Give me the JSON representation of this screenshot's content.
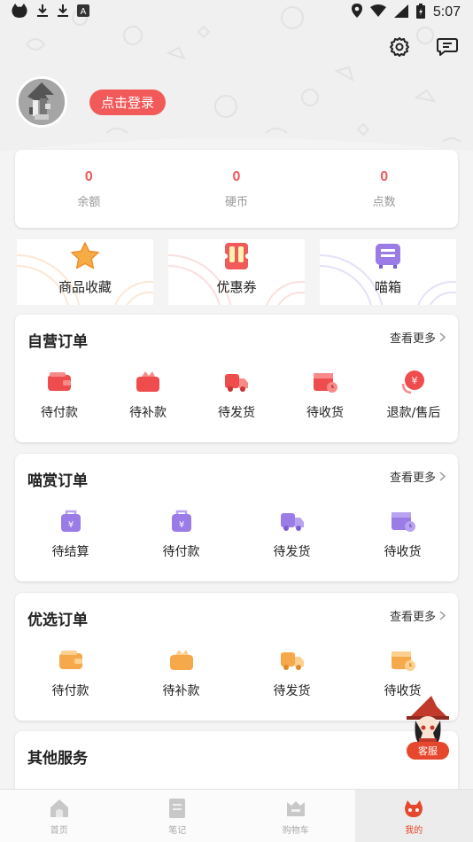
{
  "status_bar": {
    "time": "5:07",
    "icons": [
      "cat-icon",
      "download-icon",
      "download-icon",
      "a-icon",
      "location-icon",
      "wifi-icon",
      "signal-icon",
      "battery-icon"
    ]
  },
  "header": {
    "login_label": "点击登录",
    "icons": [
      "settings-icon",
      "message-icon"
    ]
  },
  "stats": [
    {
      "value": "0",
      "label": "余额"
    },
    {
      "value": "0",
      "label": "硬币"
    },
    {
      "value": "0",
      "label": "点数"
    }
  ],
  "quick": [
    {
      "label": "商品收藏",
      "icon": "star-icon"
    },
    {
      "label": "优惠券",
      "icon": "coupon-icon"
    },
    {
      "label": "喵箱",
      "icon": "box-icon"
    }
  ],
  "orders": [
    {
      "title": "自营订单",
      "more": "查看更多",
      "items": [
        "待付款",
        "待补款",
        "待发货",
        "待收货",
        "退款/售后"
      ]
    },
    {
      "title": "喵赏订单",
      "more": "查看更多",
      "items": [
        "待结算",
        "待付款",
        "待发货",
        "待收货"
      ]
    },
    {
      "title": "优选订单",
      "more": "查看更多",
      "items": [
        "待付款",
        "待补款",
        "待发货",
        "待收货"
      ]
    },
    {
      "title": "其他服务"
    }
  ],
  "customer_service": {
    "label": "客服"
  },
  "colors": {
    "accent": "#f25a5a",
    "red_icon": "#ef4d4d",
    "purple_icon": "#9b7be6",
    "orange_icon": "#f6a94b"
  },
  "tabbar": [
    {
      "label": "首页",
      "icon": "home-icon"
    },
    {
      "label": "笔记",
      "icon": "note-icon"
    },
    {
      "label": "购物车",
      "icon": "cart-icon"
    },
    {
      "label": "我的",
      "icon": "me-icon",
      "active": true
    }
  ]
}
